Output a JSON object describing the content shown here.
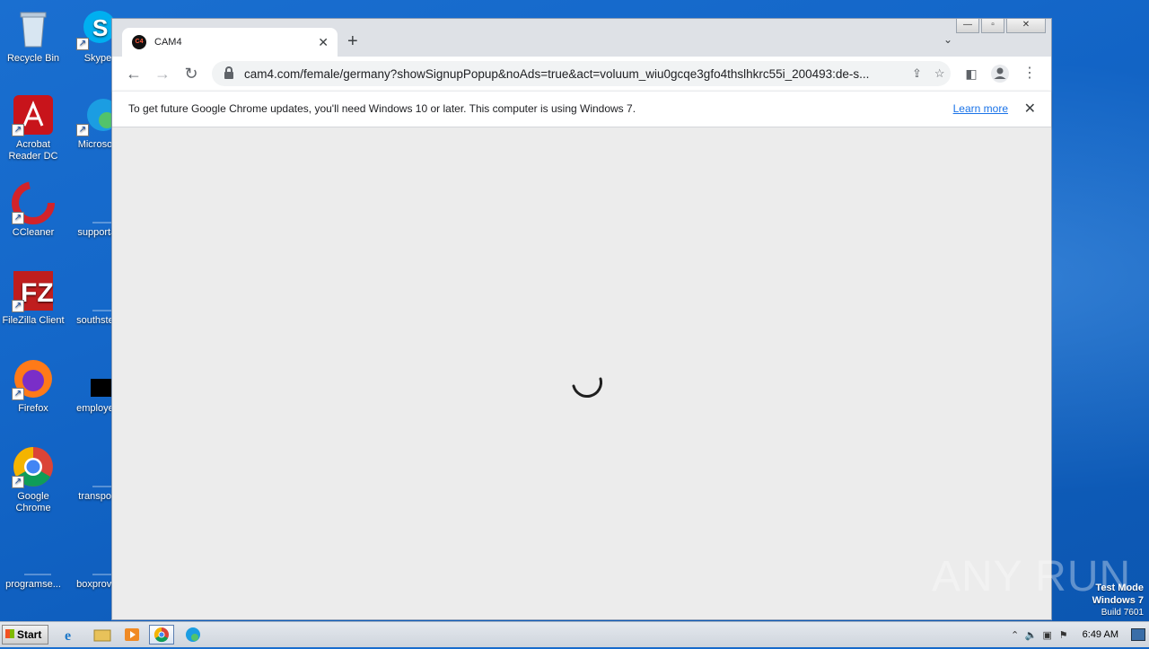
{
  "desktop": {
    "icons_left": [
      {
        "label": "Recycle Bin",
        "icon": "recycle-bin-icon"
      },
      {
        "label": "Acrobat Reader DC",
        "icon": "acrobat-icon"
      },
      {
        "label": "CCleaner",
        "icon": "ccleaner-icon"
      },
      {
        "label": "FileZilla Client",
        "icon": "filezilla-icon"
      },
      {
        "label": "Firefox",
        "icon": "firefox-icon"
      },
      {
        "label": "Google Chrome",
        "icon": "chrome-icon"
      },
      {
        "label": "programse...",
        "icon": "file-icon"
      }
    ],
    "icons_right": [
      {
        "label": "Skype",
        "icon": "skype-icon"
      },
      {
        "label": "Microsoft",
        "icon": "edge-icon"
      },
      {
        "label": "supportal",
        "icon": "file-icon"
      },
      {
        "label": "southstep",
        "icon": "file-icon"
      },
      {
        "label": "employee",
        "icon": "file-icon"
      },
      {
        "label": "transport",
        "icon": "file-icon"
      },
      {
        "label": "boxprovid",
        "icon": "file-icon"
      }
    ],
    "watermark": "ANY RUN",
    "test_mode": {
      "line1": "Test Mode",
      "line2": "Windows 7",
      "line3": "Build 7601"
    }
  },
  "browser": {
    "tab_title": "CAM4",
    "favicon_text": "C4",
    "url": "cam4.com/female/germany?showSignupPopup&noAds=true&act=voluum_wiu0gcqe3gfo4thslhkrc55i_200493:de-s...",
    "infobar": {
      "message": "To get future Google Chrome updates, you'll need Windows 10 or later. This computer is using Windows 7.",
      "link": "Learn more"
    }
  },
  "taskbar": {
    "start_label": "Start",
    "clock": "6:49 AM"
  }
}
